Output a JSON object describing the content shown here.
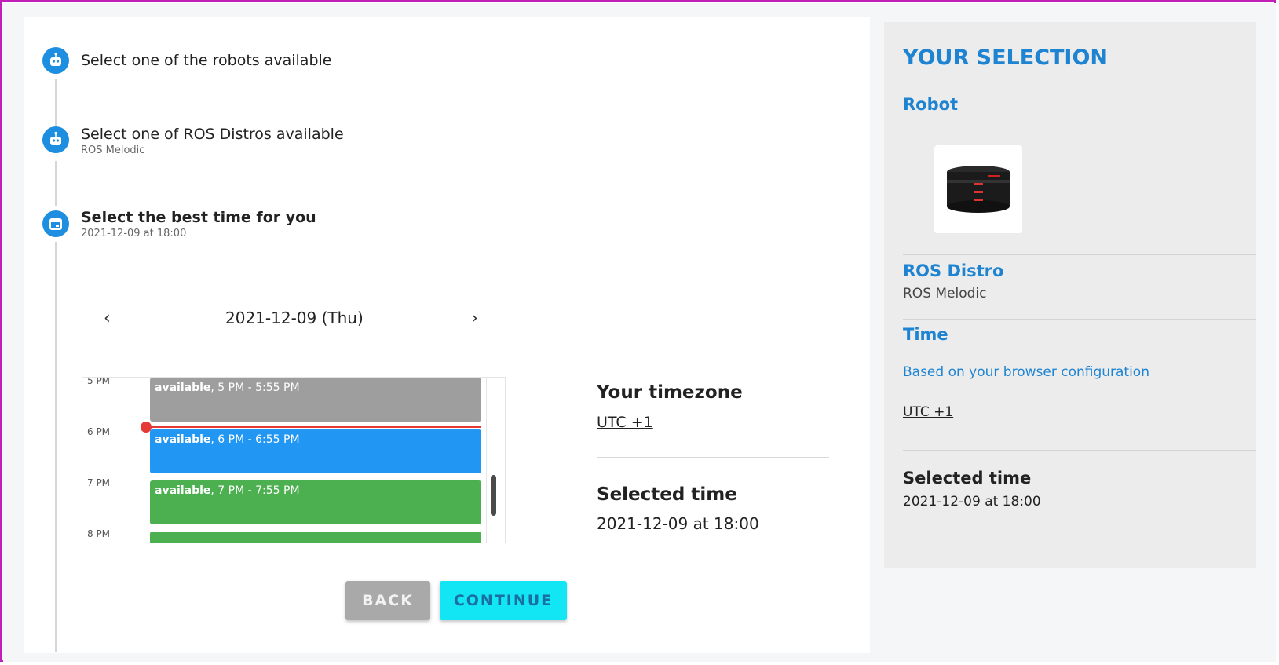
{
  "steps": [
    {
      "title": "Select one of the robots available",
      "subtitle": ""
    },
    {
      "title": "Select one of ROS Distros available",
      "subtitle": "ROS Melodic"
    },
    {
      "title": "Select the best time for you",
      "subtitle": "2021-12-09 at 18:00"
    }
  ],
  "calendar": {
    "date_label": "2021-12-09 (Thu)",
    "hours": [
      "5 PM",
      "6 PM",
      "7 PM",
      "8 PM"
    ],
    "events": [
      {
        "status": "available",
        "range": ", 5 PM - 5:55 PM",
        "color": "#9e9e9e"
      },
      {
        "status": "available",
        "range": ", 6 PM - 6:55 PM",
        "color": "#2196f3"
      },
      {
        "status": "available",
        "range": ", 7 PM - 7:55 PM",
        "color": "#4caf50"
      },
      {
        "status": "",
        "range": "",
        "color": "#4caf50"
      }
    ]
  },
  "info": {
    "timezone_label": "Your timezone",
    "timezone_value": "UTC +1",
    "selected_label": "Selected time",
    "selected_value": "2021-12-09 at 18:00"
  },
  "buttons": {
    "back": "BACK",
    "continue": "CONTINUE"
  },
  "panel": {
    "title": "YOUR SELECTION",
    "robot_label": "Robot",
    "distro_label": "ROS Distro",
    "distro_value": "ROS Melodic",
    "time_label": "Time",
    "browser_note": "Based on your browser configuration",
    "utc": "UTC +1",
    "selected_label": "Selected time",
    "selected_value": "2021-12-09 at 18:00"
  },
  "colors": {
    "accent": "#1e84d2",
    "step_icon": "#1e8fe0",
    "continue_bg": "#12e6f5",
    "now_line": "#e53935"
  }
}
